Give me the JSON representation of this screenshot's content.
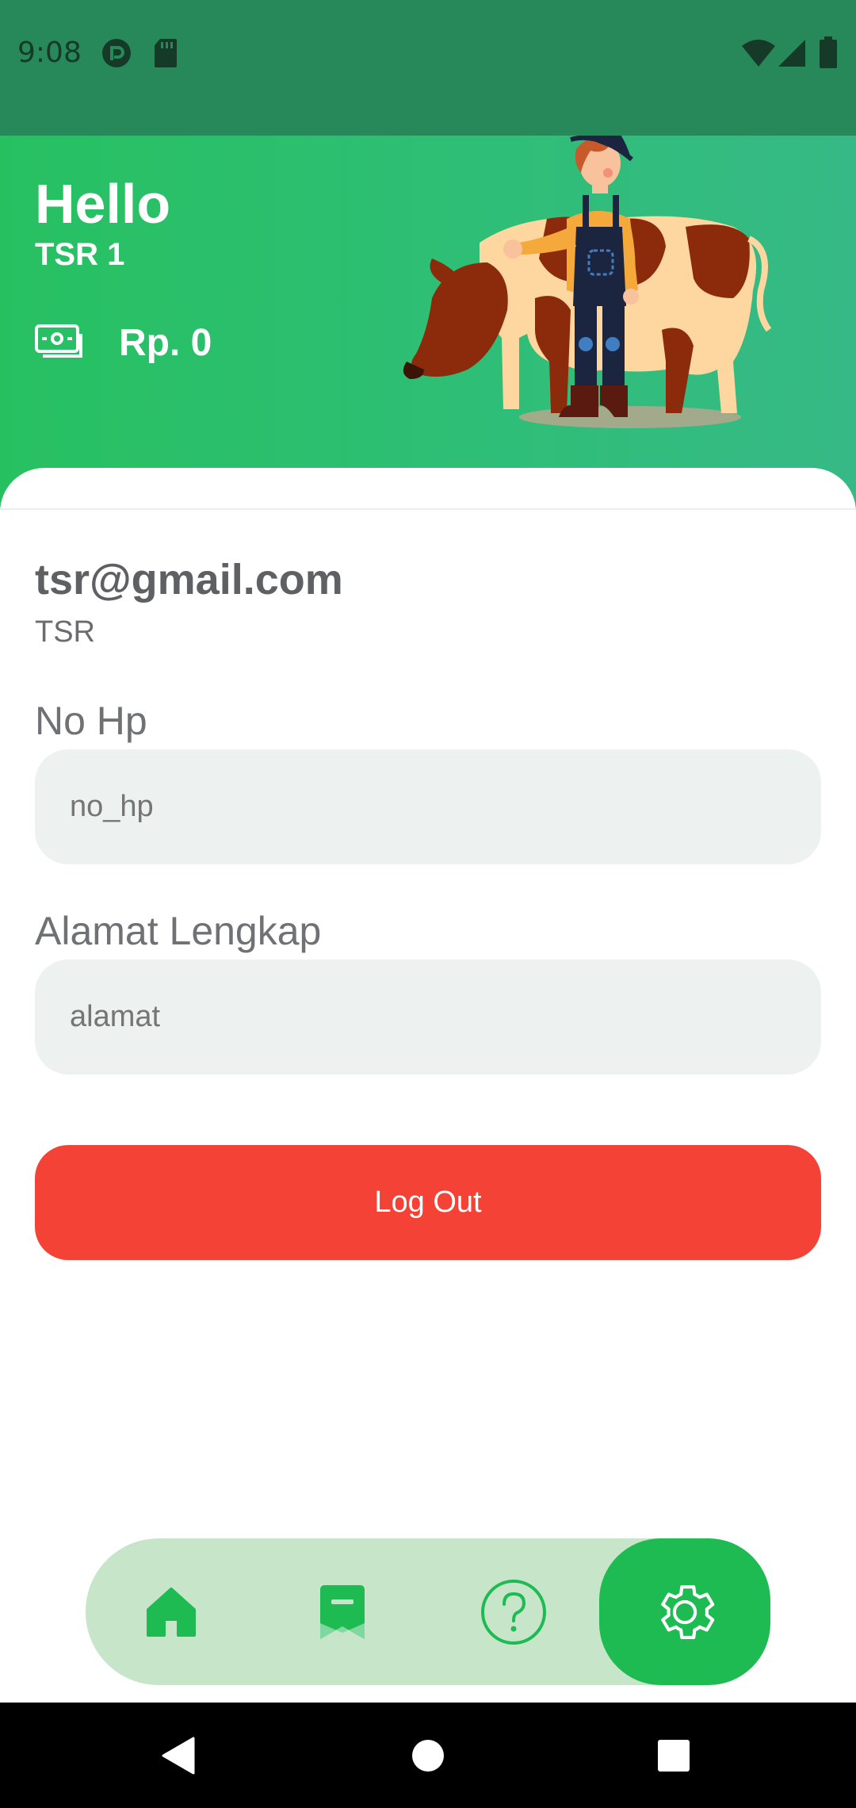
{
  "status_bar": {
    "time": "9:08",
    "left_icons": [
      "vpn-icon",
      "sd-card-icon"
    ],
    "right_icons": [
      "wifi-icon",
      "signal-icon",
      "battery-icon"
    ]
  },
  "header": {
    "greeting": "Hello",
    "user_name": "TSR 1",
    "balance_icon": "money-icon",
    "balance": "Rp. 0",
    "illustration": "farmer-with-cow-illustration",
    "colors": {
      "gradient_start": "#27c061",
      "gradient_end": "#36b986"
    }
  },
  "profile": {
    "email": "tsr@gmail.com",
    "role": "TSR"
  },
  "form": {
    "phone": {
      "label": "No Hp",
      "value": "no_hp",
      "placeholder": "no_hp"
    },
    "address": {
      "label": "Alamat Lengkap",
      "value": "alamat",
      "placeholder": "alamat"
    }
  },
  "logout": {
    "label": "Log Out",
    "color": "#f44336"
  },
  "bottom_nav": {
    "items": [
      {
        "name": "home",
        "icon": "home-icon"
      },
      {
        "name": "bookmark",
        "icon": "bookmark-icon"
      },
      {
        "name": "help",
        "icon": "help-icon"
      },
      {
        "name": "settings",
        "icon": "gear-icon",
        "active": true
      }
    ],
    "colors": {
      "background": "#c7e5c9",
      "active": "#1dbb52"
    }
  },
  "system_nav": {
    "buttons": [
      "back-icon",
      "home-circle-icon",
      "recents-icon"
    ]
  }
}
